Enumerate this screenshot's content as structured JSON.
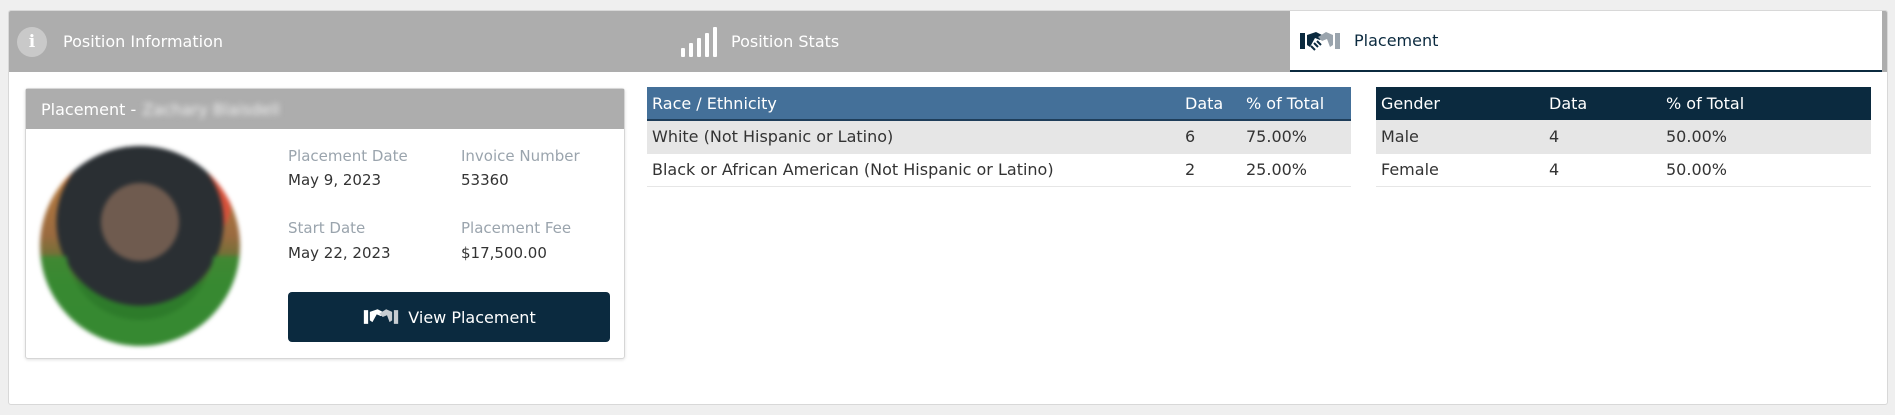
{
  "tabs": [
    {
      "label": "Position Information",
      "icon": "info-icon",
      "active": false
    },
    {
      "label": "Position Stats",
      "icon": "signal-bars-icon",
      "active": false
    },
    {
      "label": "Placement",
      "icon": "handshake-icon",
      "active": true
    }
  ],
  "card": {
    "header_prefix": "Placement -",
    "header_name": "Zachary Blaisdell",
    "placement_date_label": "Placement Date",
    "placement_date": "May 9, 2023",
    "invoice_label": "Invoice Number",
    "invoice_number": "53360",
    "start_date_label": "Start Date",
    "start_date": "May 22, 2023",
    "fee_label": "Placement Fee",
    "fee": "$17,500.00",
    "button_label": "View Placement"
  },
  "race_table": {
    "headers": [
      "Race / Ethnicity",
      "Data",
      "% of Total"
    ],
    "rows": [
      [
        "White (Not Hispanic or Latino)",
        "6",
        "75.00%"
      ],
      [
        "Black or African American (Not Hispanic or Latino)",
        "2",
        "25.00%"
      ]
    ]
  },
  "gender_table": {
    "headers": [
      "Gender",
      "Data",
      "% of Total"
    ],
    "rows": [
      [
        "Male",
        "4",
        "50.00%"
      ],
      [
        "Female",
        "4",
        "50.00%"
      ]
    ]
  },
  "colors": {
    "tab_bar": "#adadad",
    "navy": "#0b2a3f",
    "race_header": "#447099",
    "row_shade": "#e6e6e6"
  }
}
